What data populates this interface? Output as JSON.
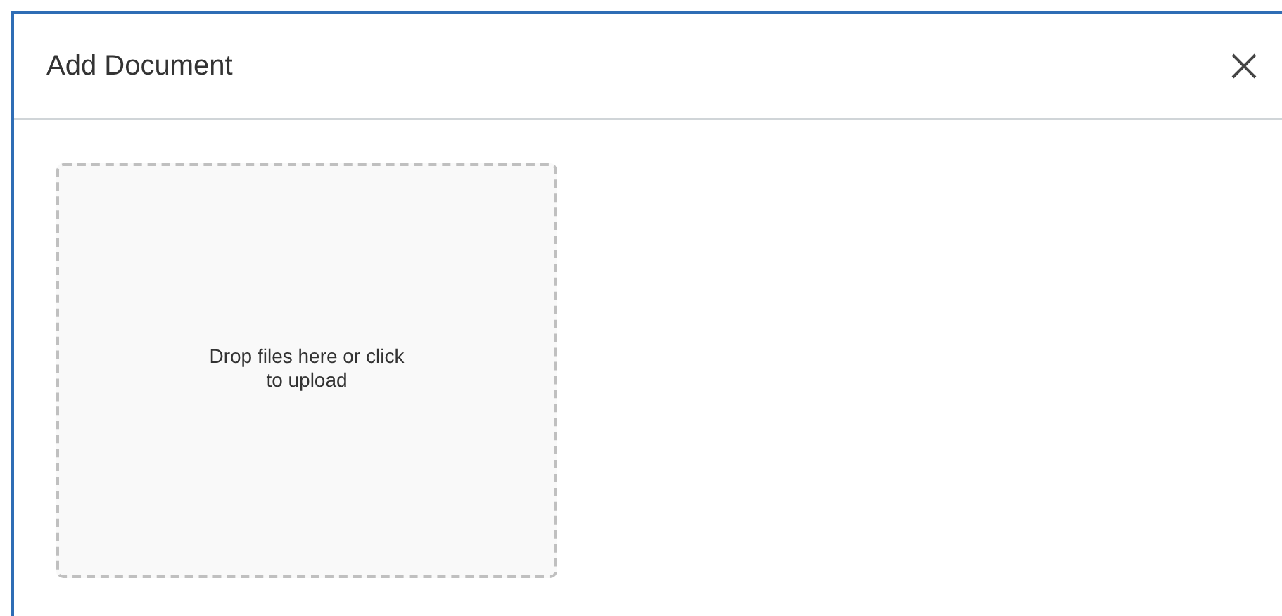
{
  "dialog": {
    "title": "Add Document"
  },
  "dropzone": {
    "text": "Drop files here or click to upload"
  }
}
